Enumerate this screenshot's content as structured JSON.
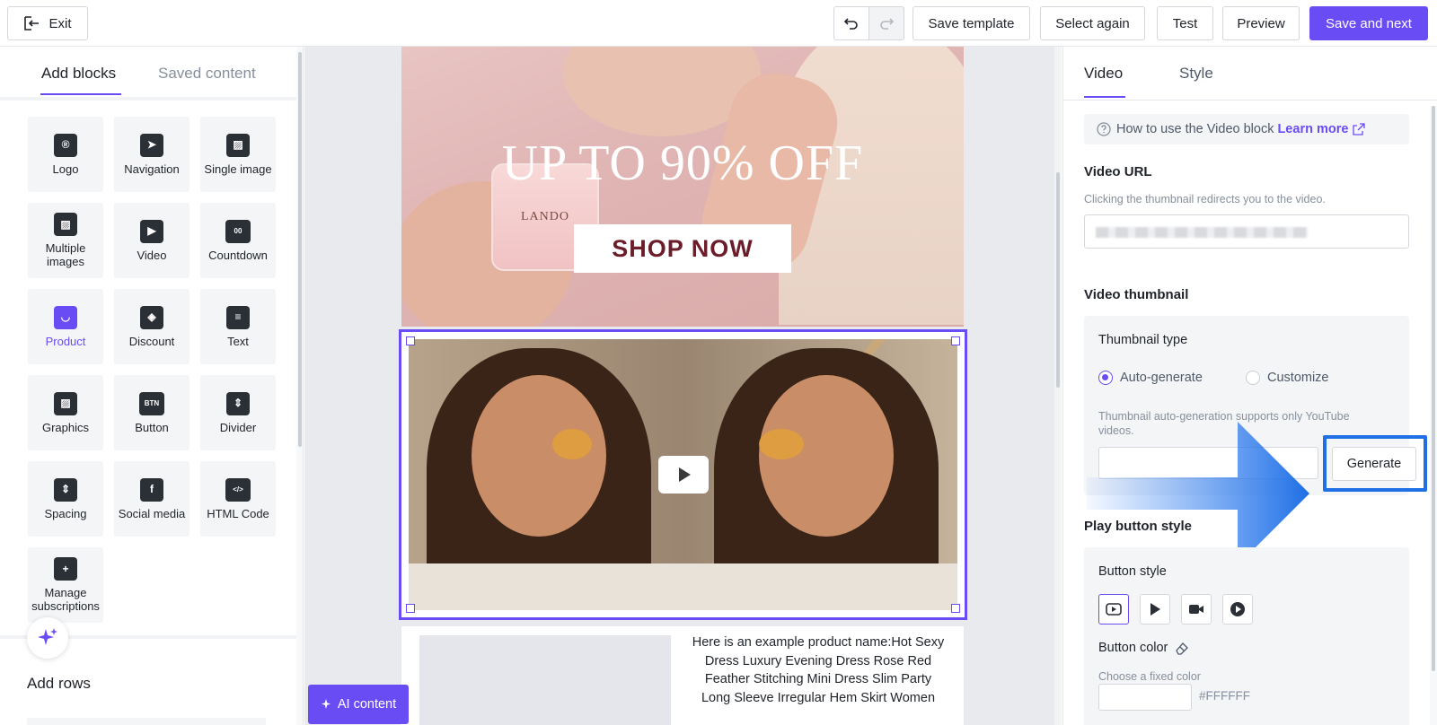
{
  "topbar": {
    "exit_label": "Exit",
    "save_template": "Save template",
    "select_again": "Select again",
    "test": "Test",
    "preview": "Preview",
    "save_next": "Save and next"
  },
  "left": {
    "tabs": [
      "Add blocks",
      "Saved content"
    ],
    "blocks": [
      {
        "label": "Logo",
        "icon": "logo-icon"
      },
      {
        "label": "Navigation",
        "icon": "navigation-icon"
      },
      {
        "label": "Single image",
        "icon": "image-icon"
      },
      {
        "label": "Multiple images",
        "icon": "images-icon"
      },
      {
        "label": "Video",
        "icon": "video-icon"
      },
      {
        "label": "Countdown",
        "icon": "countdown-icon"
      },
      {
        "label": "Product",
        "icon": "bag-icon"
      },
      {
        "label": "Discount",
        "icon": "tag-icon"
      },
      {
        "label": "Text",
        "icon": "text-icon"
      },
      {
        "label": "Graphics",
        "icon": "graphics-icon"
      },
      {
        "label": "Button",
        "icon": "button-icon"
      },
      {
        "label": "Divider",
        "icon": "divider-icon"
      },
      {
        "label": "Spacing",
        "icon": "spacing-icon"
      },
      {
        "label": "Social media",
        "icon": "facebook-icon"
      },
      {
        "label": "HTML Code",
        "icon": "code-icon"
      },
      {
        "label": "Manage subscriptions",
        "icon": "bookmark-plus-icon"
      }
    ],
    "add_rows": "Add rows",
    "ai_content": "AI content"
  },
  "canvas": {
    "headline": "UP TO 90% OFF",
    "jar_brand": "LANDO",
    "shop_now": "SHOP NOW",
    "product_text": "Here is an example product name:Hot Sexy Dress Luxury Evening Dress Rose Red Feather Stitching Mini Dress Slim Party Long Sleeve Irregular Hem Skirt Women"
  },
  "right": {
    "tabs": [
      "Video",
      "Style"
    ],
    "help_text": "How to use the Video block",
    "learn_more": "Learn more",
    "video_url_title": "Video URL",
    "video_url_hint": "Clicking the thumbnail redirects you to the video.",
    "video_thumbnail_title": "Video thumbnail",
    "thumbnail_type": "Thumbnail type",
    "radio_auto": "Auto-generate",
    "radio_custom": "Customize",
    "auto_hint": "Thumbnail auto-generation supports only YouTube videos.",
    "generate": "Generate",
    "play_button_style": "Play button style",
    "button_style": "Button style",
    "button_color": "Button color",
    "choose_fixed": "Choose a fixed color",
    "color_value": "#FFFFFF"
  },
  "colors": {
    "accent": "#6a4cf5",
    "highlight": "#1f6fe5"
  }
}
